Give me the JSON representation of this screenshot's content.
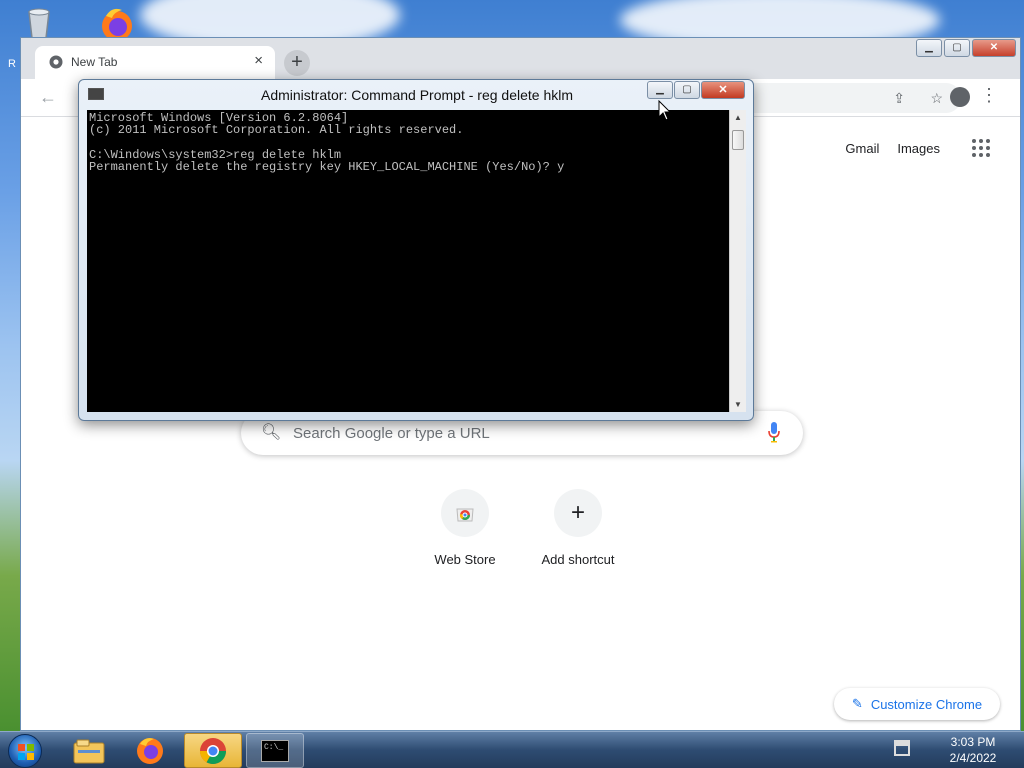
{
  "desktop": {
    "partial_text": "R"
  },
  "chrome": {
    "tab_title": "New Tab",
    "tab_close": "×",
    "new_tab": "+",
    "top_links": {
      "gmail": "Gmail",
      "images": "Images"
    },
    "search_placeholder": "Search Google or type a URL",
    "shortcuts": [
      {
        "label": "Web Store",
        "icon": "chrome-web-store-icon"
      },
      {
        "label": "Add shortcut",
        "icon": "plus-icon",
        "glyph": "+"
      }
    ],
    "customize_label": "Customize Chrome"
  },
  "cmd": {
    "title": "Administrator: Command Prompt - reg  delete hklm",
    "lines": [
      "Microsoft Windows [Version 6.2.8064]",
      "(c) 2011 Microsoft Corporation. All rights reserved.",
      "",
      "C:\\Windows\\system32>reg delete hklm",
      "Permanently delete the registry key HKEY_LOCAL_MACHINE (Yes/No)? y"
    ]
  },
  "taskbar": {
    "time": "3:03 PM",
    "date": "2/4/2022",
    "cmd_button_text": "C:\\_"
  },
  "colors": {
    "chrome_accent": "#1a73e8",
    "console_bg": "#000000",
    "console_text": "#c0c0c0",
    "taskbar": "#2e4c72"
  }
}
